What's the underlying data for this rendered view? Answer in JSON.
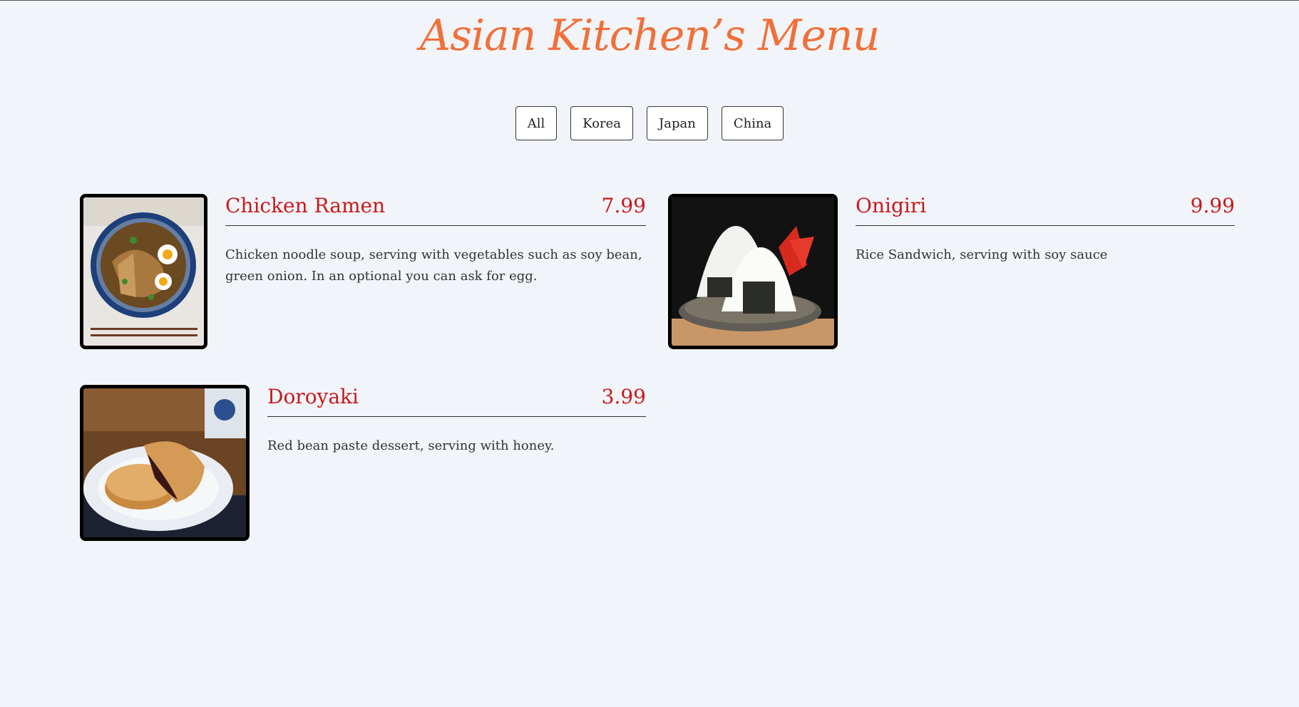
{
  "title": "Asian Kitchen’s Menu",
  "filters": [
    "All",
    "Korea",
    "Japan",
    "China"
  ],
  "colors": {
    "title": "#f0703a",
    "item_name": "#c8191c",
    "background": "#f1f4f8"
  },
  "items": [
    {
      "name": "Chicken Ramen",
      "price": "7.99",
      "description": "Chicken noodle soup, serving with vegetables such as soy bean, green onion. In an optional you can ask for egg.",
      "image_icon": "ramen-bowl-image"
    },
    {
      "name": "Onigiri",
      "price": "9.99",
      "description": "Rice Sandwich, serving with soy sauce",
      "image_icon": "onigiri-image"
    },
    {
      "name": "Doroyaki",
      "price": "3.99",
      "description": "Red bean paste dessert, serving with honey.",
      "image_icon": "dorayaki-image"
    }
  ]
}
